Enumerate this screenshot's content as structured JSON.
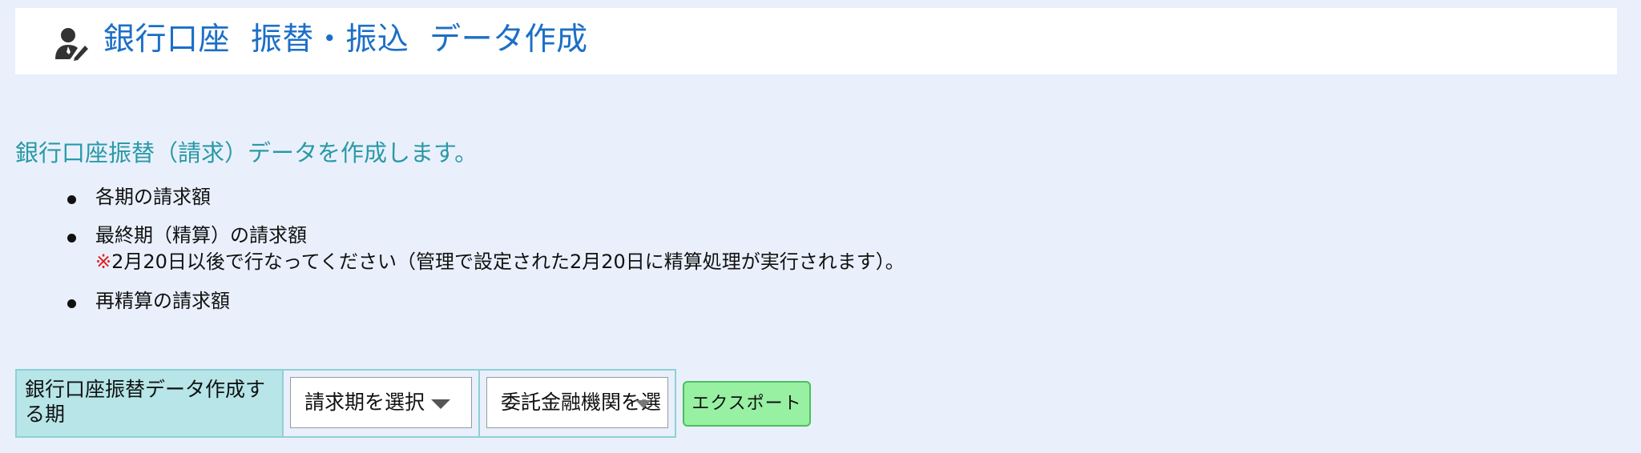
{
  "header": {
    "icon": "user-edit-icon",
    "title": "銀行口座  振替・振込  データ作成"
  },
  "intro": "銀行口座振替（請求）データを作成します。",
  "bullets": [
    {
      "text": "各期の請求額"
    },
    {
      "text": "最終期（精算）の請求額",
      "note_mark": "※",
      "note_text": "2月20日以後で行なってください（管理で設定された2月20日に精算処理が実行されます）。"
    },
    {
      "text": "再精算の請求額"
    }
  ],
  "form": {
    "label": "銀行口座振替データ作成する期",
    "period_select": {
      "value": "請求期を選択"
    },
    "bank_select": {
      "value": "委託金融機関を選"
    },
    "export_label": "エクスポート"
  },
  "colors": {
    "page_bg": "#e9f0fc",
    "title": "#1c6fc6",
    "intro": "#2a9aa6",
    "note_mark": "#e02020",
    "label_cell": "#b7e5e8",
    "export_button": "#98f0a3"
  }
}
